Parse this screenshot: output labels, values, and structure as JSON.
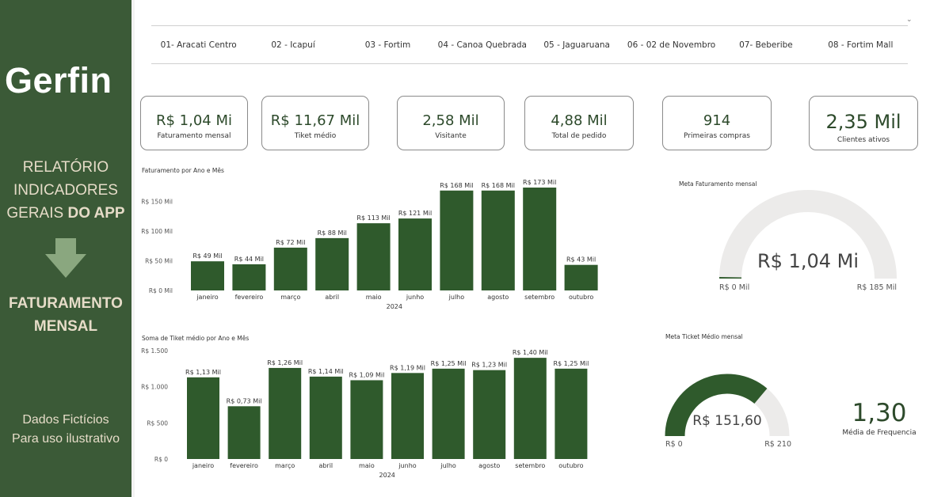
{
  "sidebar": {
    "logo": "Gerfin",
    "report_lines": [
      "RELATÓRIO",
      "INDICADORES",
      "GERAIS"
    ],
    "report_bold": "DO APP",
    "section_lines": [
      "FATURAMENTO",
      "MENSAL"
    ],
    "note_lines": [
      "Dados Fictícios",
      "Para uso ilustrativo"
    ],
    "accent_color": "#3b5a37",
    "text_color": "#e6dcc8",
    "arrow_icon": "arrow-down-icon",
    "arrow_color": "#8aa77f"
  },
  "stores": [
    "01- Aracati Centro",
    "02 - Icapuí",
    "03 - Fortim",
    "04 - Canoa Quebrada",
    "05 - Jaguaruana",
    "06 - 02 de Novembro",
    "07- Beberibe",
    "08 - Fortim Mall"
  ],
  "kpis": [
    {
      "value": "R$ 1,04 Mi",
      "label": "Faturamento mensal"
    },
    {
      "value": "R$ 11,67 Mil",
      "label": "Tiket médio"
    },
    {
      "value": "2,58 Mil",
      "label": "Visitante"
    },
    {
      "value": "4,88 Mil",
      "label": "Total de pedido"
    },
    {
      "value": "914",
      "label": "Primeiras compras"
    },
    {
      "value": "2,35 Mil",
      "label": "Clientes ativos"
    }
  ],
  "chart_data": [
    {
      "type": "bar",
      "title": "Faturamento por Ano e Mês",
      "categories": [
        "janeiro",
        "fevereiro",
        "março",
        "abril",
        "maio",
        "junho",
        "julho",
        "agosto",
        "setembro",
        "outubro"
      ],
      "values": [
        49,
        44,
        72,
        88,
        113,
        121,
        168,
        168,
        173,
        43
      ],
      "data_labels": [
        "R$ 49 Mil",
        "R$ 44 Mil",
        "R$ 72 Mil",
        "R$ 88 Mil",
        "R$ 113 Mil",
        "R$ 121 Mil",
        "R$ 168 Mil",
        "R$ 168 Mil",
        "R$ 173 Mil",
        "R$ 43 Mil"
      ],
      "ytick_values": [
        0,
        50,
        100,
        150
      ],
      "yticks": [
        "R$ 0 Mil",
        "R$ 50 Mil",
        "R$ 100 Mil",
        "R$ 150 Mil"
      ],
      "ylim": [
        0,
        185
      ],
      "xlabel": "2024",
      "color": "#2f5a2c",
      "grid": false
    },
    {
      "type": "bar",
      "title": "Soma de Tiket médio por Ano e Mês",
      "categories": [
        "janeiro",
        "fevereiro",
        "março",
        "abril",
        "maio",
        "junho",
        "julho",
        "agosto",
        "setembro",
        "outubro"
      ],
      "values": [
        1130,
        730,
        1260,
        1140,
        1090,
        1190,
        1250,
        1230,
        1400,
        1250
      ],
      "data_labels": [
        "R$ 1,13 Mil",
        "R$ 0,73 Mil",
        "R$ 1,26 Mil",
        "R$ 1,14 Mil",
        "R$ 1,09 Mil",
        "R$ 1,19 Mil",
        "R$ 1,25 Mil",
        "R$ 1,23 Mil",
        "R$ 1,40 Mil",
        "R$ 1,25 Mil"
      ],
      "ytick_values": [
        0,
        500,
        1000,
        1500
      ],
      "yticks": [
        "R$ 0",
        "R$ 500",
        "R$ 1.000",
        "R$ 1.500"
      ],
      "ylim": [
        0,
        1500
      ],
      "xlabel": "2024",
      "color": "#2f5a2c",
      "grid": false
    }
  ],
  "gauges": [
    {
      "title": "Meta Faturamento mensal",
      "value": 1.04,
      "max": 185,
      "display": "R$ 1,04 Mi",
      "min_label": "R$ 0 Mil",
      "max_label": "R$ 185 Mil",
      "color": "#2f5a2c",
      "track": "#ecebea"
    },
    {
      "title": "Meta Ticket Médio mensal",
      "value": 151.6,
      "max": 210,
      "display": "R$ 151,60",
      "min_label": "R$ 0",
      "max_label": "R$ 210",
      "color": "#2f5a2c",
      "track": "#ecebea"
    }
  ],
  "frequency": {
    "value": "1,30",
    "label": "Média de Frequencia"
  }
}
